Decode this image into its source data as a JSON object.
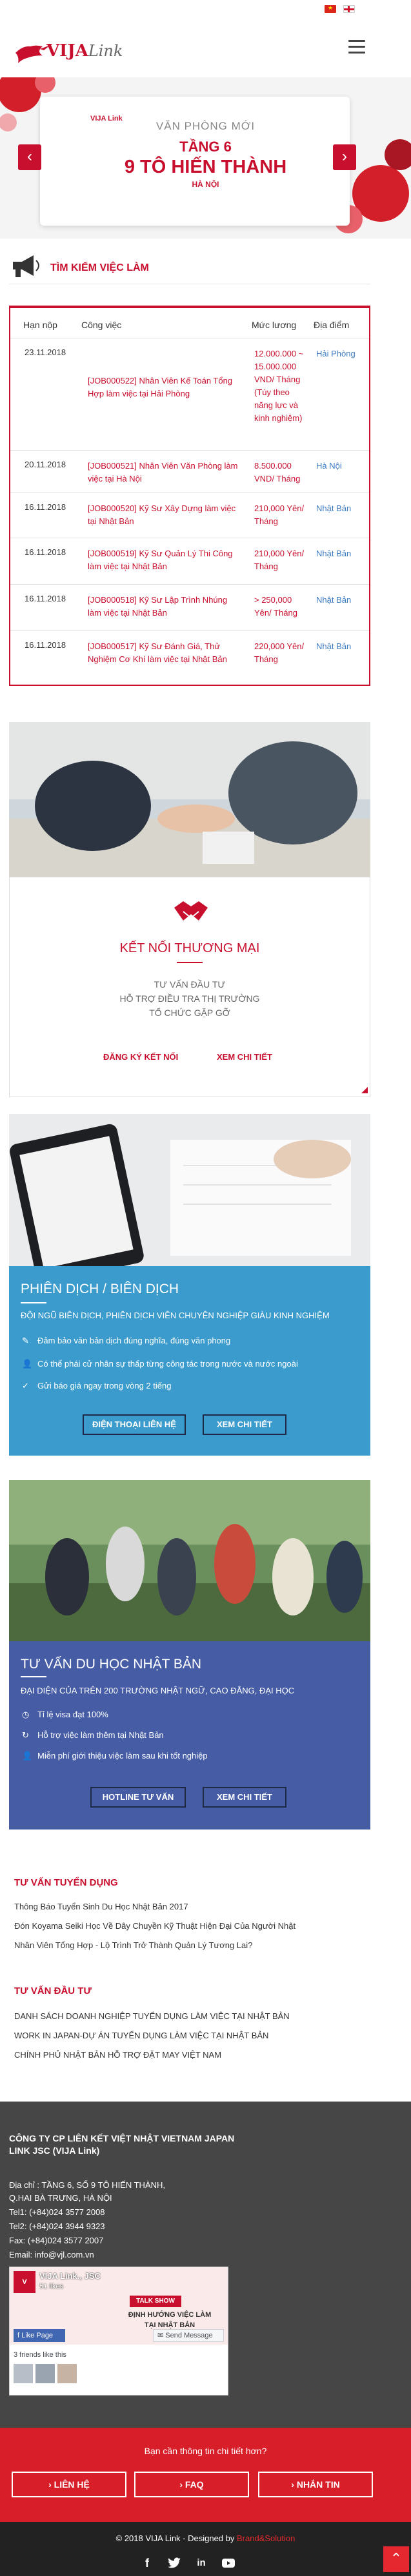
{
  "header": {
    "logo": {
      "brand": "VIJA",
      "brand_suffix": "Link"
    }
  },
  "banner": {
    "card_logo": "VIJA Link",
    "line1": "VĂN PHÒNG MỚI",
    "line2": "TẦNG 6",
    "line3": "9 TÔ HIẾN THÀNH",
    "line4": "HÀ NỘI"
  },
  "jobs": {
    "title": "TÌM KIẾM VIỆC LÀM",
    "headers": {
      "date": "Hạn nộp",
      "job": "Công việc",
      "salary": "Mức lương",
      "place": "Địa điểm"
    },
    "rows": [
      {
        "date": "23.11.2018",
        "job": "[JOB000522] Nhân Viên Kế Toán Tổng Hợp làm việc tại Hải Phòng",
        "salary": "12.000.000 ~ 15.000.000 VND/ Tháng (Tùy theo năng lực và kinh nghiệm)",
        "place": "Hải Phòng"
      },
      {
        "date": "20.11.2018",
        "job": "[JOB000521] Nhân Viên Văn Phòng làm việc tại Hà Nội",
        "salary": "8.500.000 VND/ Tháng",
        "place": "Hà Nội"
      },
      {
        "date": "16.11.2018",
        "job": "[JOB000520] Kỹ Sư Xây Dựng làm việc tại Nhật Bản",
        "salary": "210,000 Yên/ Tháng",
        "place": "Nhật Bản"
      },
      {
        "date": "16.11.2018",
        "job": "[JOB000519] Kỹ Sư Quản Lý Thi Công làm việc tại Nhật Bản",
        "salary": "210,000 Yên/ Tháng",
        "place": "Nhật Bản"
      },
      {
        "date": "16.11.2018",
        "job": "[JOB000518] Kỹ Sư Lập Trình Nhúng làm việc tại Nhật Bản",
        "salary": "> 250,000 Yên/ Tháng",
        "place": "Nhật Bản"
      },
      {
        "date": "16.11.2018",
        "job": "[JOB000517] Kỹ Sư Đánh Giá, Thử Nghiệm Cơ Khí làm việc tại Nhật Bản",
        "salary": "220,000 Yên/ Tháng",
        "place": "Nhật Bản"
      }
    ]
  },
  "trade": {
    "title": "KẾT NỐI THƯƠNG MẠI",
    "line1": "TƯ VẤN ĐẦU TƯ",
    "line2": "HỖ TRỢ ĐIỀU TRA THỊ TRƯỜNG",
    "line3": "TỔ CHỨC GẶP GỠ",
    "register": "ĐĂNG KÝ KẾT NỐI",
    "details": "XEM CHI TIẾT"
  },
  "translation": {
    "title": "PHIÊN DỊCH / BIÊN DỊCH",
    "sub": "ĐỘI NGŨ BIÊN DỊCH, PHIÊN DỊCH VIÊN CHUYÊN NGHIỆP GIÀU KINH NGHIỆM",
    "bullets": [
      "Đảm bảo văn bản dịch đúng nghĩa, đúng văn phong",
      "Có thể phái cử nhân sự thấp từng công tác trong nước và nước ngoài",
      "Gửi báo giá ngay trong vòng 2 tiếng"
    ],
    "phone_btn": "ĐIỆN THOẠI LIÊN HỆ",
    "details_btn": "XEM CHI TIẾT"
  },
  "study": {
    "title": "TƯ VẤN DU HỌC NHẬT BẢN",
    "sub": "ĐẠI DIỆN CỦA TRÊN 200 TRƯỜNG NHẬT NGỮ, CAO ĐẲNG, ĐẠI HỌC",
    "bullets": [
      "Tỉ lệ visa đạt 100%",
      "Hỗ trợ việc làm thêm tại Nhật Bản",
      "Miễn phí giới thiệu việc làm sau khi tốt nghiệp"
    ],
    "hotline_btn": "HOTLINE TƯ VẤN",
    "details_btn": "XEM CHI TIẾT"
  },
  "recruit": {
    "title": "TƯ VẤN TUYỂN DỤNG",
    "items": [
      "Thông Báo Tuyển Sinh Du Học Nhật Bản 2017",
      "Đón Koyama Seiki Học Về Dây Chuyền Kỹ Thuật Hiện Đại Của Người Nhật",
      "Nhân Viên Tổng Hợp - Lộ Trình Trở Thành Quản Lý Tương Lai?"
    ]
  },
  "invest": {
    "title": "TƯ VẤN ĐẦU TƯ",
    "items": [
      "DANH SÁCH DOANH NGHIỆP TUYỂN DỤNG LÀM VIỆC TẠI NHẬT BẢN",
      "WORK IN JAPAN-DỰ ÁN TUYỂN DỤNG LÀM VIỆC TẠI NHẬT BẢN",
      "CHÍNH PHỦ NHẬT BẢN HỖ TRỢ ĐẶT MAY VIỆT NAM"
    ]
  },
  "footer": {
    "company": "CÔNG TY CP LIÊN KẾT VIỆT NHẬT VIETNAM JAPAN LINK JSC (VIJA Link)",
    "addr1": "Địa chỉ : TẦNG 6, SỐ 9 TÔ HIẾN THÀNH,",
    "addr2": "Q.HAI BÀ TRƯNG, HÀ NỘI",
    "tel1": "Tel1: (+84)024 3577 2008",
    "tel2": "Tel2: (+84)024 3944 9323",
    "fax": "Fax: (+84)024 3577 2007",
    "email": "Email: info@vjl.com.vn",
    "fb_name": "VIJA Link., JSC",
    "fb_likes": "51 likes",
    "fb_like_btn": "Like Page",
    "fb_send_btn": "Send Message",
    "fb_friends": "3 friends like this",
    "fb_talk": "TALK SHOW",
    "fb_promo1": "ĐỊNH HƯỚNG VIỆC LÀM",
    "fb_promo2": "TẠI NHẬT BẢN"
  },
  "cta": {
    "question": "Bạn cần thông tin chi tiết hơn?",
    "contact": "LIÊN HỆ",
    "faq": "FAQ",
    "message": "NHẮN TIN"
  },
  "copyright": {
    "text": "© 2018 VIJA Link - Designed by",
    "designer": "Brand&Solution"
  },
  "colors": {
    "brand_red": "#c8102e",
    "blue": "#3b9bcc",
    "indigo": "#465da6",
    "footer": "#464646"
  }
}
